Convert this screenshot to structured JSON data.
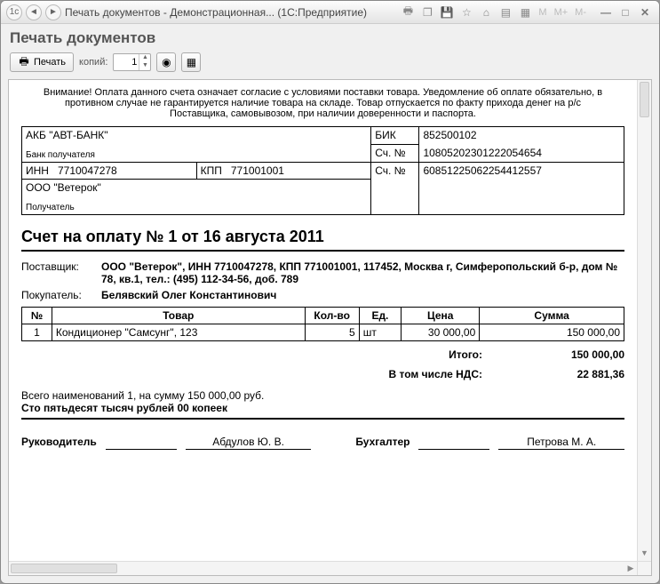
{
  "titlebar": {
    "title": "Печать документов - Демонстрационная...   (1С:Предприятие)"
  },
  "header": {
    "title": "Печать документов"
  },
  "toolbar": {
    "print_label": "Печать",
    "copies_label": "копий:",
    "copies_value": "1"
  },
  "warning": "Внимание! Оплата данного счета означает согласие с условиями поставки товара. Уведомление об оплате обязательно, в противном случае не гарантируется наличие товара на складе. Товар отпускается по факту прихода денег на р/с Поставщика, самовывозом, при наличии доверенности и паспорта.",
  "bank": {
    "bank_name": "АКБ \"АВТ-БАНК\"",
    "bank_sub": "Банк получателя",
    "inn_label": "ИНН",
    "inn": "7710047278",
    "kpp_label": "КПП",
    "kpp": "771001001",
    "payee": "ООО \"Ветерок\"",
    "payee_sub": "Получатель",
    "bik_label": "БИК",
    "bik": "852500102",
    "acc_label": "Сч. №",
    "acc1": "10805202301222054654",
    "acc2": "60851225062254412557"
  },
  "doc_title": "Счет на оплату № 1 от 16 августа 2011",
  "supplier_label": "Поставщик:",
  "supplier": "ООО \"Ветерок\", ИНН 7710047278, КПП 771001001, 117452, Москва г, Симферопольский б-р, дом № 78, кв.1, тел.: (495) 112-34-56, доб. 789",
  "buyer_label": "Покупатель:",
  "buyer": "Белявский Олег Константинович",
  "cols": {
    "num": "№",
    "goods": "Товар",
    "qty": "Кол-во",
    "unit": "Ед.",
    "price": "Цена",
    "sum": "Сумма"
  },
  "rows": [
    {
      "num": "1",
      "goods": "Кондиционер \"Самсунг\", 123",
      "qty": "5",
      "unit": "шт",
      "price": "30 000,00",
      "sum": "150 000,00"
    }
  ],
  "totals": {
    "total_label": "Итого:",
    "total": "150 000,00",
    "vat_label": "В том числе НДС:",
    "vat": "22 881,36"
  },
  "sum_line": "Всего наименований 1, на сумму 150 000,00 руб.",
  "sum_words": "Сто пятьдесят тысяч рублей 00 копеек",
  "sign": {
    "head_label": "Руководитель",
    "head_name": "Абдулов Ю. В.",
    "acc_label": "Бухгалтер",
    "acc_name": "Петрова М. А."
  }
}
